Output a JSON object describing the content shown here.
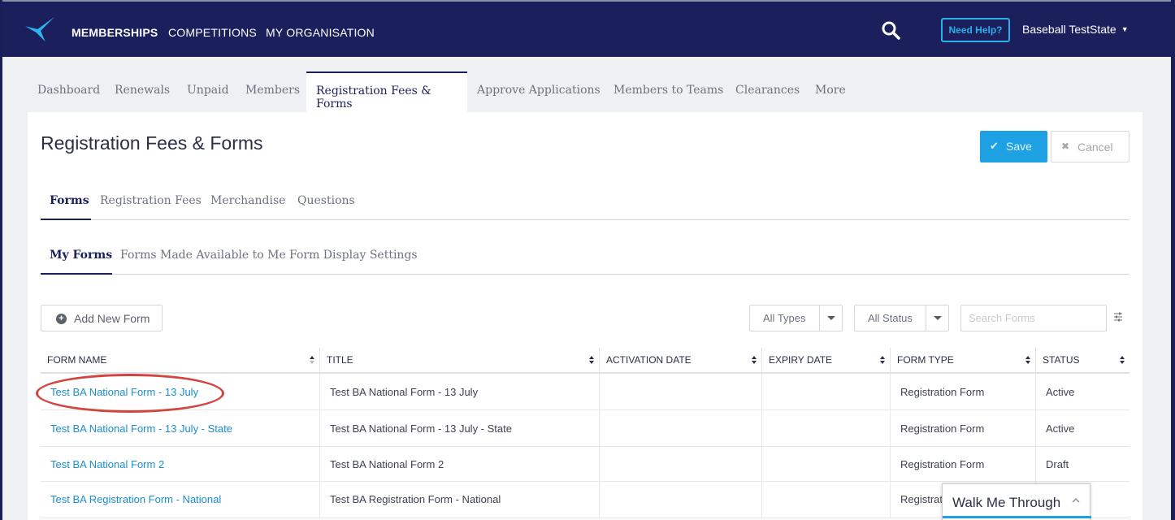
{
  "topnav": {
    "items": [
      {
        "label": "MEMBERSHIPS",
        "active": true
      },
      {
        "label": "COMPETITIONS",
        "active": false
      },
      {
        "label": "MY ORGANISATION",
        "active": false
      }
    ],
    "help_label": "Need Help?",
    "user_name": "Baseball TestState",
    "logo_icon": "star-logo-icon",
    "search_icon": "search-icon"
  },
  "subnav": {
    "tabs": [
      "Dashboard",
      "Renewals",
      "Unpaid",
      "Members",
      "Registration Fees & Forms",
      "Approve Applications",
      "Members to Teams",
      "Clearances",
      "More"
    ],
    "active": "Registration Fees & Forms"
  },
  "page": {
    "title": "Registration Fees & Forms",
    "save_label": "Save",
    "cancel_label": "Cancel"
  },
  "section_tabs": {
    "items": [
      "Forms",
      "Registration Fees",
      "Merchandise",
      "Questions"
    ],
    "active": "Forms"
  },
  "form_tabs": {
    "items": [
      "My Forms",
      "Forms Made Available to Me",
      "Form Display Settings"
    ],
    "active": "My Forms"
  },
  "toolbar": {
    "add_label": "Add New Form",
    "type_filter": "All Types",
    "status_filter": "All Status",
    "search_placeholder": "Search Forms"
  },
  "table": {
    "columns": [
      "FORM NAME",
      "TITLE",
      "ACTIVATION DATE",
      "EXPIRY DATE",
      "FORM TYPE",
      "STATUS"
    ],
    "rows": [
      {
        "name": "Test BA National Form - 13 July",
        "title": "Test BA National Form - 13 July",
        "activation": "",
        "expiry": "",
        "type": "Registration Form",
        "status": "Active"
      },
      {
        "name": "Test BA National Form - 13 July - State",
        "title": "Test BA National Form - 13 July - State",
        "activation": "",
        "expiry": "",
        "type": "Registration Form",
        "status": "Active"
      },
      {
        "name": "Test BA National Form 2",
        "title": "Test BA National Form 2",
        "activation": "",
        "expiry": "",
        "type": "Registration Form",
        "status": "Draft"
      },
      {
        "name": "Test BA Registration Form - National",
        "title": "Test BA Registration Form - National",
        "activation": "",
        "expiry": "",
        "type": "Registrat",
        "status": ""
      }
    ]
  },
  "walk_widget": {
    "label": "Walk Me Through"
  },
  "colors": {
    "brand": "#1b1f5c",
    "accent": "#1ea1e3",
    "link": "#1a8fd0",
    "highlight": "#d2453f"
  }
}
